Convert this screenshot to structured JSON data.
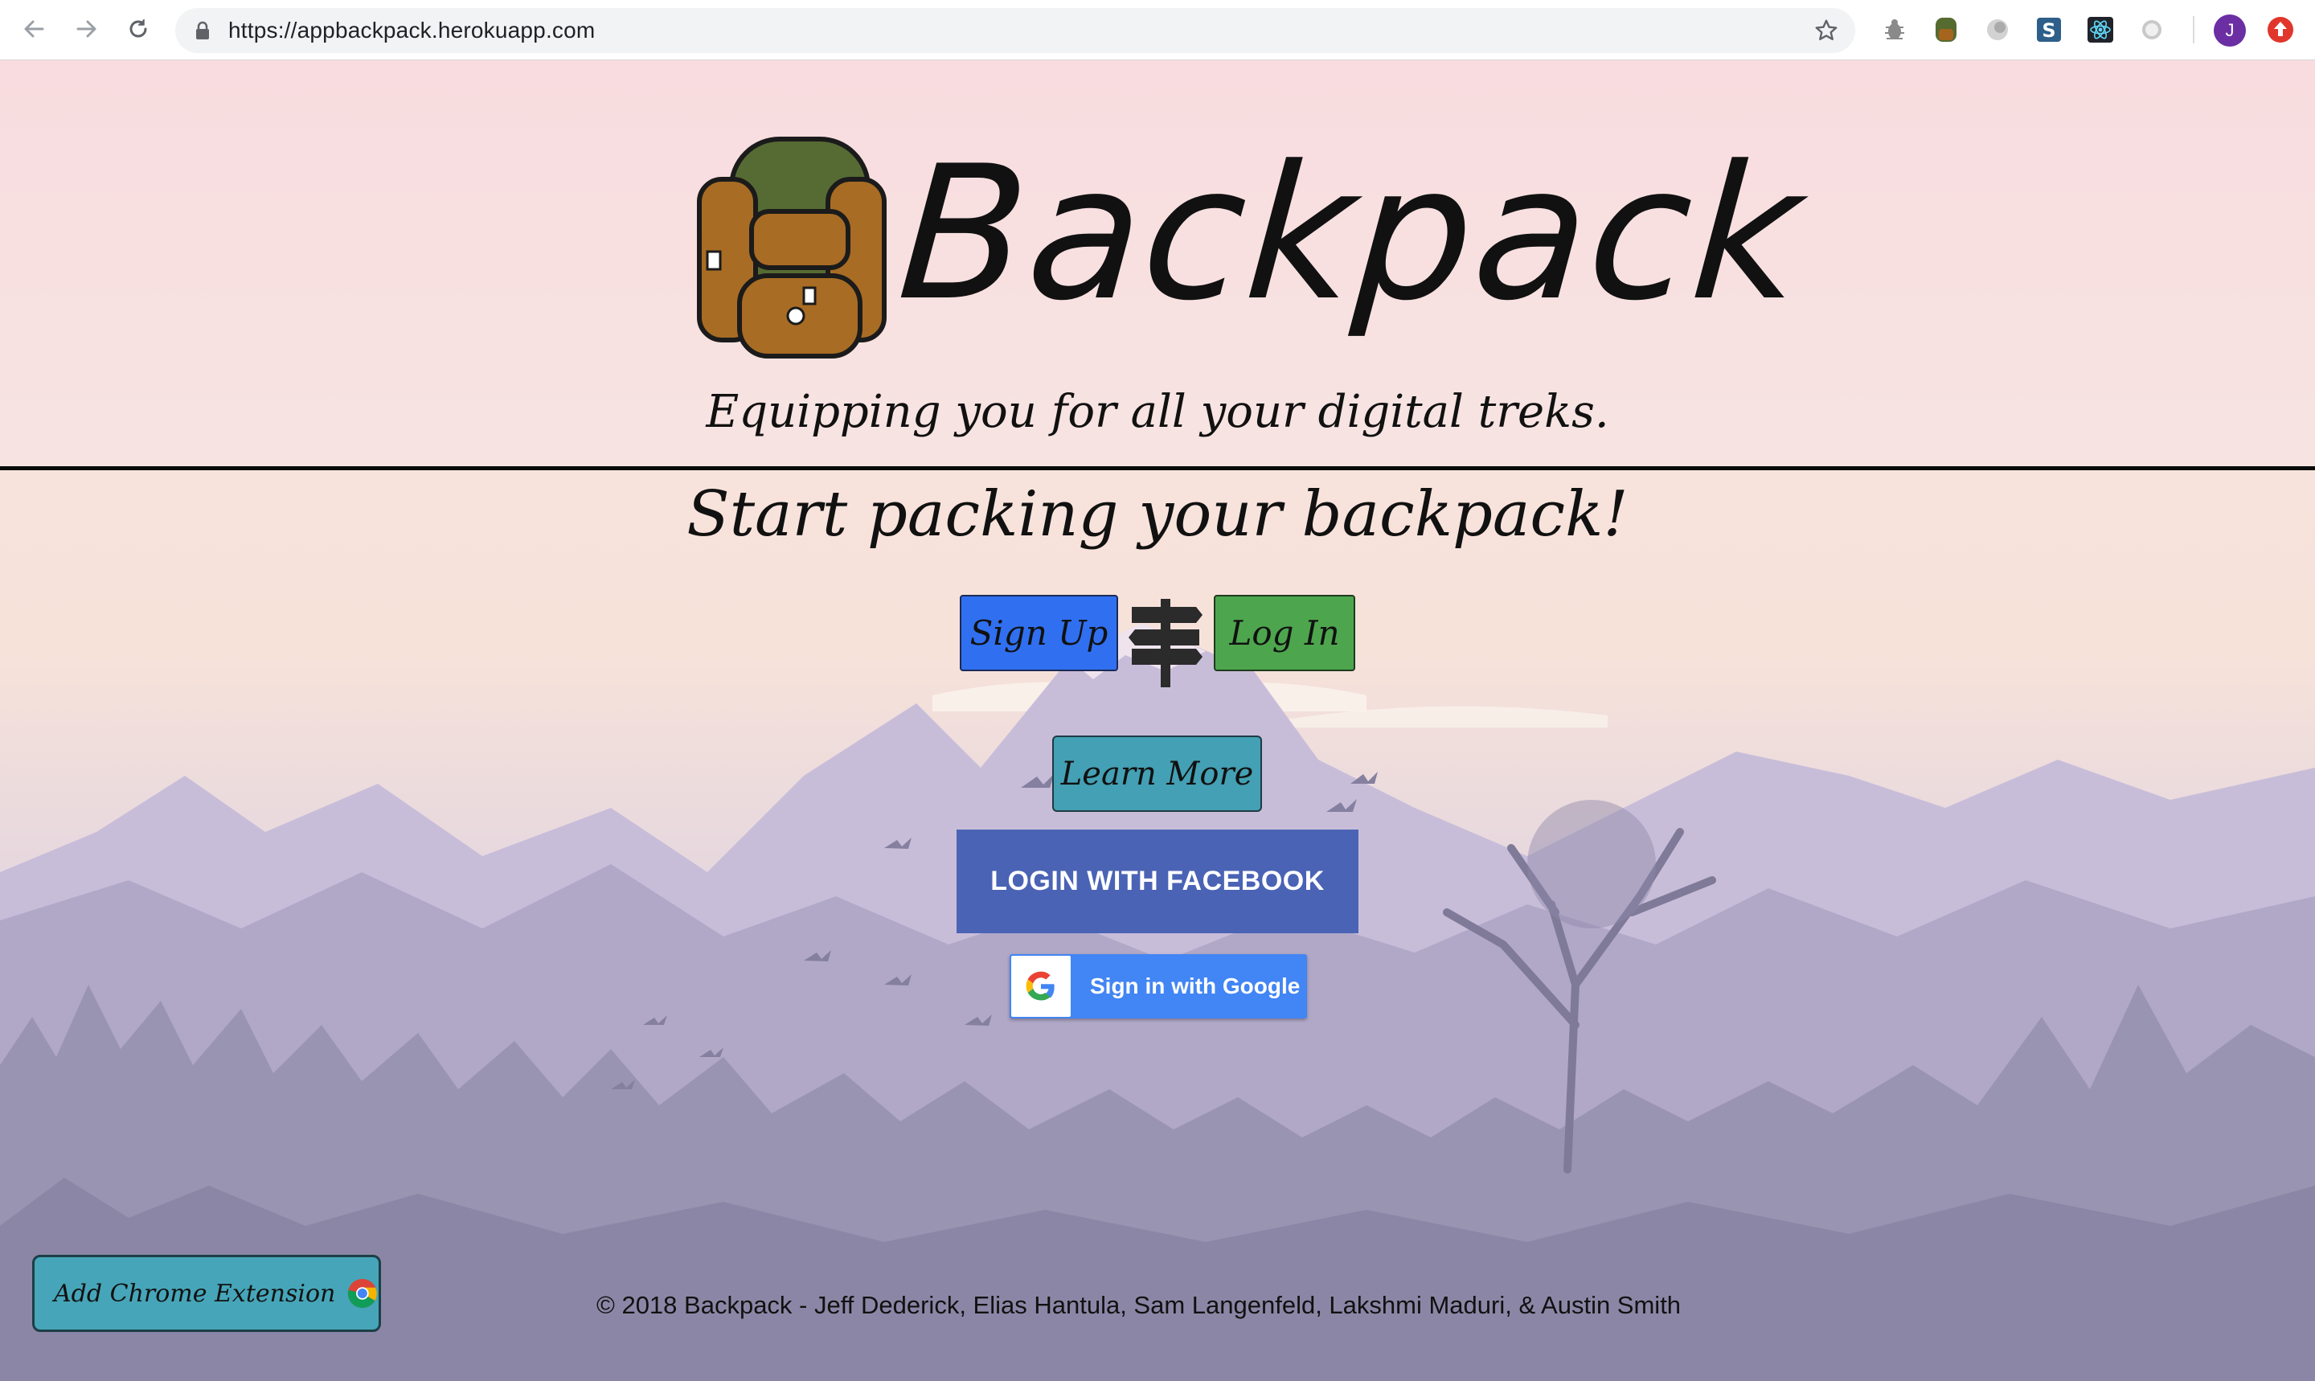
{
  "browser": {
    "url": "https://appbackpack.herokuapp.com",
    "profile_initial": "J",
    "icons": [
      "back-arrow-icon",
      "forward-arrow-icon",
      "reload-icon",
      "lock-icon",
      "bookmark-star-icon"
    ],
    "extensions": [
      "bug-extension-icon",
      "backpack-extension-icon",
      "gray-circle-extension-icon",
      "s-extension-icon",
      "react-extension-icon",
      "white-circle-extension-icon",
      "red-upload-extension-icon"
    ]
  },
  "header": {
    "brand": "Backpack",
    "tagline": "Equipping you for all your digital treks."
  },
  "main": {
    "headline": "Start packing your backpack!",
    "signup_label": "Sign Up",
    "login_label": "Log In",
    "learn_more_label": "Learn More",
    "facebook_label": "LOGIN WITH FACEBOOK",
    "google_label": "Sign in with Google"
  },
  "extension_button": {
    "label": "Add Chrome Extension"
  },
  "footer": {
    "text": "© 2018 Backpack - Jeff Dederick, Elias Hantula, Sam Langenfeld, Lakshmi Maduri, & Austin Smith"
  },
  "colors": {
    "signup": "#3070f0",
    "login": "#4da64d",
    "learn_more": "#44a0b4",
    "facebook": "#4a63b5",
    "google": "#4285f4",
    "header_band": "#f8dcdf"
  }
}
